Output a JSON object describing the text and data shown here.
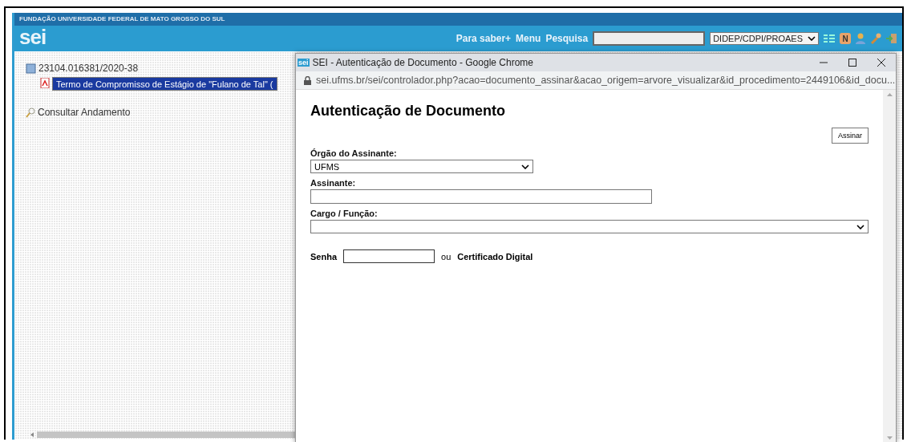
{
  "header": {
    "institution": "FUNDAÇÃO UNIVERSIDADE FEDERAL DE MATO GROSSO DO SUL",
    "logo": "sei",
    "links": [
      "Para saber+",
      "Menu",
      "Pesquisa"
    ],
    "unit_select": "DIDEP/CDPI/PROAES",
    "notes_letter": "N"
  },
  "tree": {
    "process": "23104.016381/2020-38",
    "children": [
      {
        "label": "Termo de Compromisso de Estágio de \"Fulano de Tal\" (",
        "selected": true
      }
    ]
  },
  "side_link": "Consultar Andamento",
  "popup": {
    "favicon": "sei",
    "title": "SEI - Autenticação de Documento - Google Chrome",
    "url": "sei.ufms.br/sei/controlador.php?acao=documento_assinar&acao_origem=arvore_visualizar&id_procedimento=2449106&id_docu...",
    "heading": "Autenticação de Documento",
    "sign_button": "Assinar",
    "fields": [
      {
        "kind": "select",
        "label": "Órgão do Assinante:",
        "value": "UFMS"
      },
      {
        "kind": "text",
        "label": "Assinante:"
      },
      {
        "kind": "wideselect",
        "label": "Cargo / Função:"
      }
    ],
    "password_label": "Senha",
    "or": "ou",
    "certificate": "Certificado Digital"
  }
}
